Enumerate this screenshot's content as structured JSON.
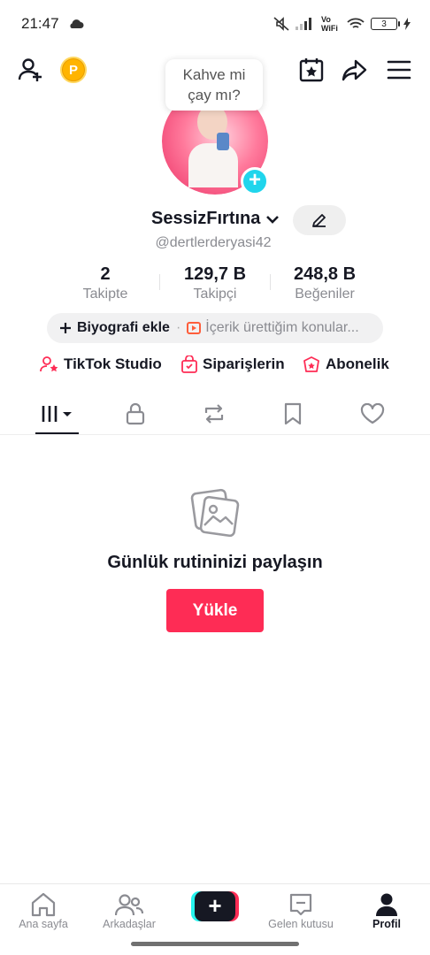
{
  "status": {
    "time": "21:47",
    "network": "Vo WiFi",
    "battery": "3"
  },
  "bubble": {
    "line1": "Kahve mi",
    "line2": "çay mı?"
  },
  "profile": {
    "username": "SessizFırtına",
    "handle": "@dertlerderyasi42",
    "stats": [
      {
        "value": "2",
        "label": "Takipte"
      },
      {
        "value": "129,7 B",
        "label": "Takipçi"
      },
      {
        "value": "248,8 B",
        "label": "Beğeniler"
      }
    ],
    "bio_add": "Biyografi ekle",
    "bio_prompt": "İçerik ürettiğim konular..."
  },
  "links": [
    {
      "label": "TikTok Studio",
      "icon": "person-star-icon"
    },
    {
      "label": "Siparişlerin",
      "icon": "shopping-bag-icon"
    },
    {
      "label": "Abonelik",
      "icon": "subscription-icon"
    }
  ],
  "tabs": [
    "videos-grid-icon",
    "lock-icon",
    "repost-icon",
    "bookmark-icon",
    "heart-icon"
  ],
  "empty_state": {
    "title": "Günlük rutininizi paylaşın",
    "button": "Yükle"
  },
  "bottom_nav": [
    {
      "label": "Ana sayfa",
      "icon": "home-icon"
    },
    {
      "label": "Arkadaşlar",
      "icon": "friends-icon"
    },
    {
      "label": "",
      "icon": "create-plus-icon"
    },
    {
      "label": "Gelen kutusu",
      "icon": "inbox-icon"
    },
    {
      "label": "Profil",
      "icon": "profile-icon",
      "active": true
    }
  ],
  "colors": {
    "accent": "#fe2c55",
    "cyan": "#20d5ec",
    "coin": "#ffb400"
  }
}
